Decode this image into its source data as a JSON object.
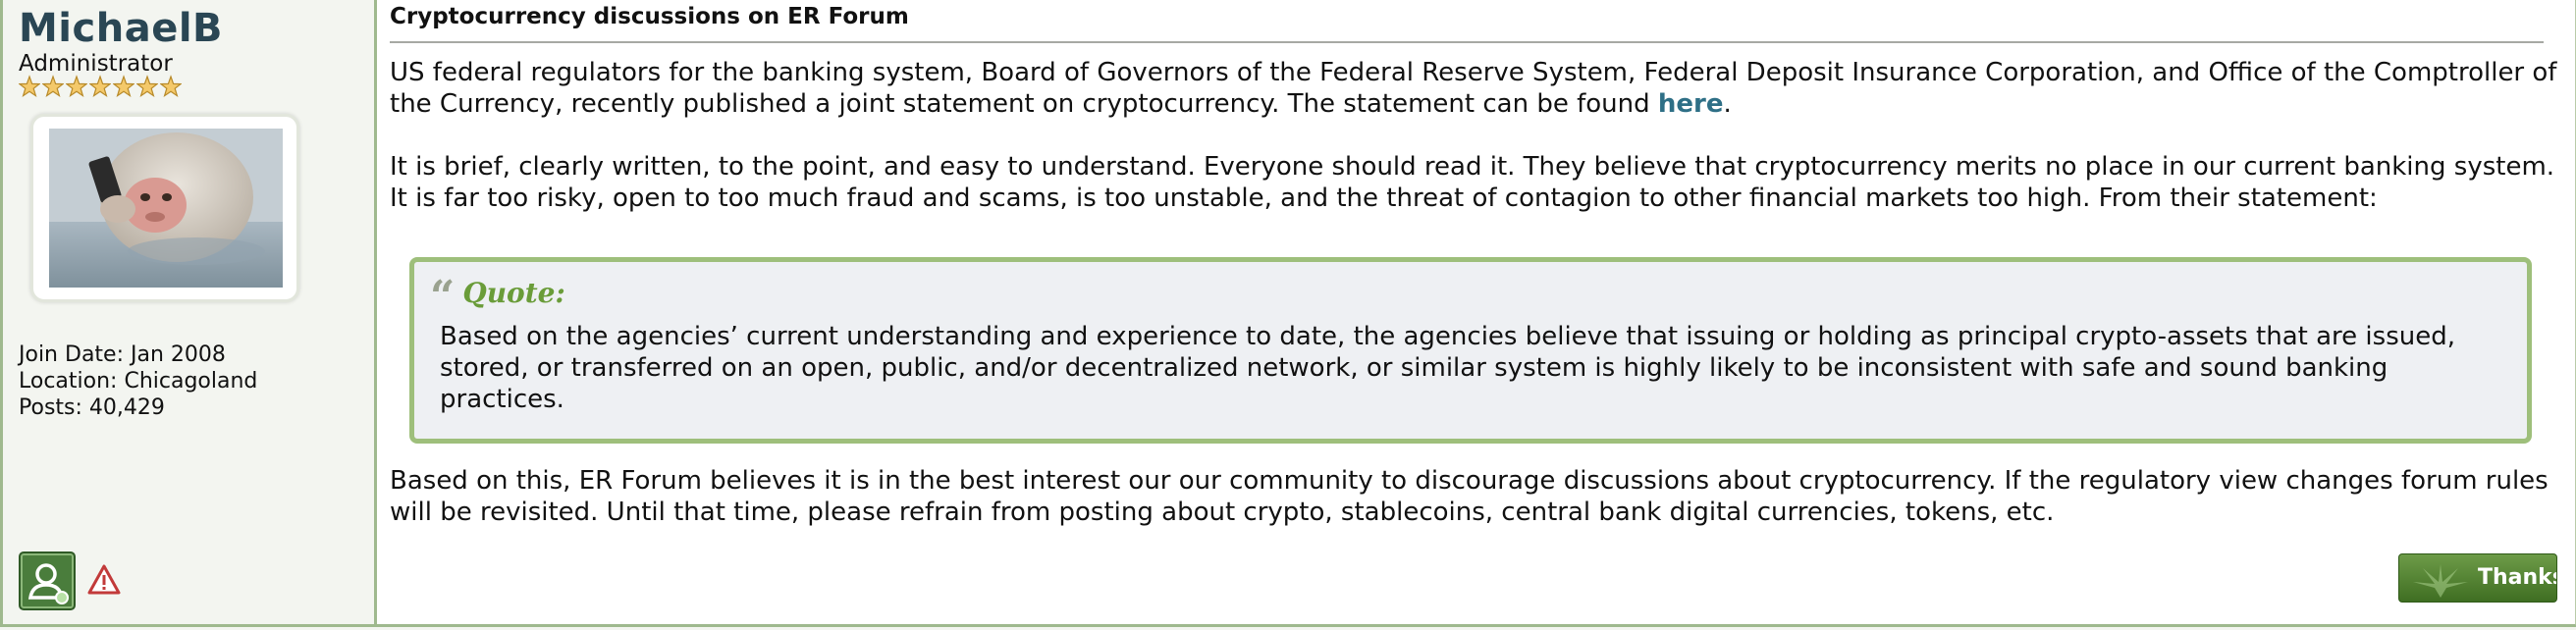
{
  "user": {
    "name": "MichaelB",
    "title": "Administrator",
    "stars": 7,
    "join_date": "Join Date: Jan 2008",
    "location": "Location: Chicagoland",
    "posts": "Posts: 40,429"
  },
  "post": {
    "title": "Cryptocurrency discussions on ER Forum",
    "p1_text": "US federal regulators for the banking system, Board of Governors of the Federal Reserve System, Federal Deposit Insurance Corporation, and Office of the Comptroller of the Currency, recently published a joint statement on cryptocurrency. The statement can be found ",
    "p1_link": "here",
    "p1_end": ".",
    "p2": "It is brief, clearly written, to the point, and easy to understand. Everyone should read it. They believe that cryptocurrency merits no place in our current banking system. It is far too risky, open to too much fraud and scams, is too unstable, and the threat of contagion to other financial markets too high. From their statement:",
    "quote_label": "Quote:",
    "quote_text": "Based on the agencies’ current understanding and experience to date, the agencies believe that issuing or holding as principal crypto-assets that are issued, stored, or transferred on an open, public, and/or decentralized network, or similar system is highly likely to be inconsistent with safe and sound banking practices.",
    "p3": "Based on this, ER Forum believes it is in the best interest our our community to discourage discussions about cryptocurrency. If the regulatory view changes forum rules will be revisited. Until that time, please refrain from posting about crypto, stablecoins, central bank digital currencies, tokens, etc."
  },
  "actions": {
    "thanks_label": "Thanks"
  },
  "icons": {
    "profile": "user-profile-icon",
    "report": "report-warning-icon",
    "star": "star-icon",
    "quote": "quote-mark-icon"
  },
  "colors": {
    "username": "#2a4654",
    "link": "#2e6f86",
    "quote_border": "#9ebf7b",
    "quote_label": "#6a9c39",
    "thanks_button": "#4f7f30"
  }
}
